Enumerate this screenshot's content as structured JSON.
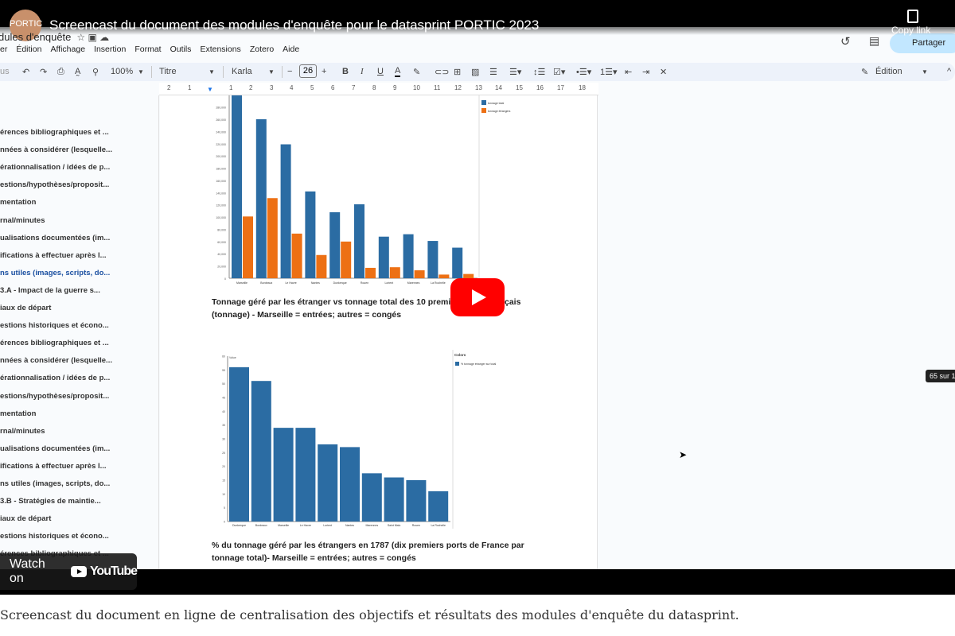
{
  "video": {
    "title": "Screencast du document des modules d'enquête pour le datasprint PORTIC 2023",
    "channel_avatar": "PORTIC",
    "copy_link": "Copy link",
    "watch_on": "Watch on",
    "youtube": "YouTube"
  },
  "docs": {
    "title": "dules d'enquête",
    "menu": [
      "er",
      "Édition",
      "Affichage",
      "Insertion",
      "Format",
      "Outils",
      "Extensions",
      "Zotero",
      "Aide"
    ],
    "toolbar": {
      "search": "us",
      "zoom": "100%",
      "style": "Titre",
      "font": "Karla",
      "font_size": "26",
      "mode": "Édition",
      "share": "Partager"
    },
    "ruler": [
      "2",
      "1",
      "1",
      "2",
      "3",
      "4",
      "5",
      "6",
      "7",
      "8",
      "9",
      "10",
      "11",
      "12",
      "13",
      "14",
      "15",
      "16",
      "17",
      "18"
    ],
    "outline": [
      "érences bibliographiques et ...",
      "nnées à considérer (lesquelle...",
      "érationnalisation / idées de p...",
      "estions/hypothèses/proposit...",
      "mentation",
      "rnal/minutes",
      "ualisations documentées (im...",
      "ifications à effectuer après l...",
      "ns utiles (images, scripts, do...",
      "3.A - Impact de la guerre s...",
      "iaux de départ",
      "estions historiques et écono...",
      "érences bibliographiques et ...",
      "nnées à considérer (lesquelle...",
      "érationnalisation / idées de p...",
      "estions/hypothèses/proposit...",
      "mentation",
      "rnal/minutes",
      "ualisations documentées (im...",
      "ifications à effectuer après l...",
      "ns utiles (images, scripts, do...",
      "3.B - Stratégies de maintie...",
      "iaux de départ",
      "estions historiques et écono...",
      "érences bibliographiques et ..."
    ],
    "outline_active": 8,
    "caption1": "Tonnage géré par les étranger vs tonnage total des 10 premiers ports français (tonnage) - Marseille = entrées; autres = congés",
    "caption2": "% du tonnage géré par les étrangers en 1787 (dix premiers ports de France par tonnage total)- Marseille = entrées; autres = congés",
    "page_badge": "65 sur 1"
  },
  "page_caption": "Screencast du document en ligne de centralisation des objectifs et résultats des modules d'enquête du datasprint.",
  "colors": {
    "blue": "#2b6ca3",
    "orange": "#ed7014",
    "docs_toolbar": "#edf2fa",
    "youtube_red": "#ff0000"
  },
  "chart_data": [
    {
      "type": "bar",
      "title": "",
      "categories": [
        "Marseille",
        "Bordeaux",
        "Le Havre",
        "Nantes",
        "Dunkerque",
        "Rouen",
        "Lorient",
        "Marennes",
        "La Rochelle",
        "Saint Malo"
      ],
      "series": [
        {
          "name": "tonnage total",
          "values": [
            300000,
            260000,
            219000,
            142000,
            108000,
            121000,
            68000,
            72000,
            61000,
            50000
          ]
        },
        {
          "name": "tonnage étrangers",
          "values": [
            101000,
            131000,
            73000,
            38000,
            60000,
            17000,
            18000,
            13000,
            6000,
            7000
          ]
        }
      ],
      "yticks": [
        "0",
        "20,000",
        "40,000",
        "60,000",
        "80,000",
        "100,000",
        "120,000",
        "140,000",
        "160,000",
        "180,000",
        "200,000",
        "220,000",
        "240,000",
        "260,000",
        "280,000"
      ],
      "ylim": [
        0,
        300000
      ],
      "legend": "top-right"
    },
    {
      "type": "bar",
      "title": "",
      "ylabel": "Value",
      "legend_title": "Colors",
      "categories": [
        "Dunkerque",
        "Bordeaux",
        "Marseille",
        "Le Havre",
        "Lorient",
        "Nantes",
        "Marennes",
        "Saint Malo",
        "Rouen",
        "La Rochelle"
      ],
      "series": [
        {
          "name": "% tonnage étranger sur total",
          "values": [
            56,
            51,
            34,
            34,
            28,
            27,
            17.5,
            16,
            15,
            11
          ]
        }
      ],
      "yticks": [
        "0",
        "5",
        "10",
        "15",
        "20",
        "25",
        "30",
        "35",
        "40",
        "45",
        "50",
        "55",
        "60"
      ],
      "ylim": [
        0,
        60
      ],
      "legend": "top-right"
    }
  ]
}
